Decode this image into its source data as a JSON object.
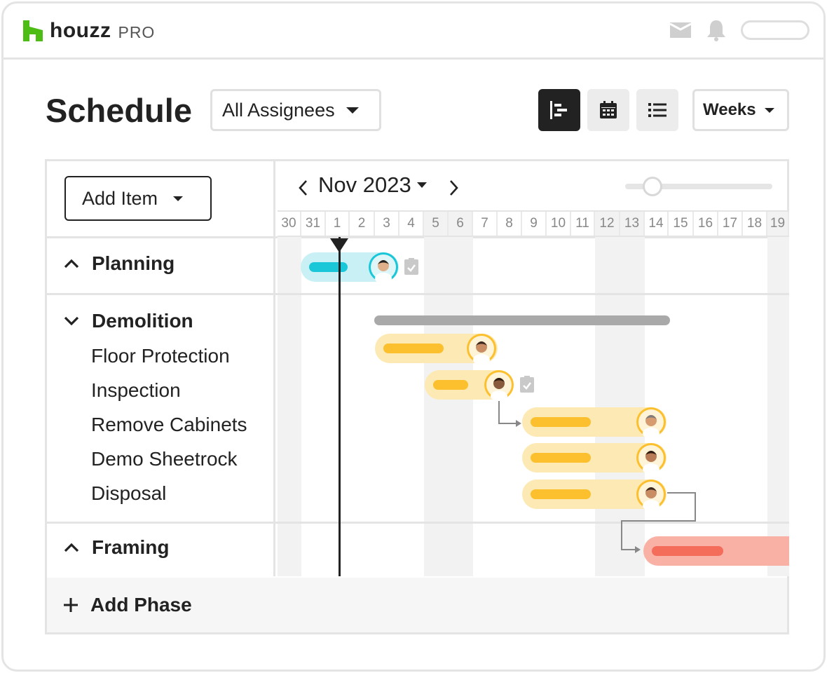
{
  "app": {
    "logo_text": "houzz",
    "logo_suffix": "PRO",
    "brand_color": "#4dbc15"
  },
  "header_icons": [
    "mail-icon",
    "bell-icon",
    "search-pill"
  ],
  "page": {
    "title": "Schedule",
    "assignee_filter": "All Assignees",
    "views": [
      "gantt-view-icon",
      "calendar-view-icon",
      "list-view-icon"
    ],
    "active_view": "gantt",
    "zoom_select": "Weeks"
  },
  "toolbar": {
    "add_item_label": "Add Item",
    "month_label": "Nov 2023"
  },
  "days": [
    "30",
    "31",
    "1",
    "2",
    "3",
    "4",
    "5",
    "6",
    "7",
    "8",
    "9",
    "10",
    "11",
    "12",
    "13",
    "14",
    "15",
    "16",
    "17",
    "18",
    "19"
  ],
  "today_label": "1",
  "phases": [
    {
      "name": "Planning",
      "expanded": false,
      "color": "#1ac7d8",
      "tasks": []
    },
    {
      "name": "Demolition",
      "expanded": true,
      "color": "#fcc02e",
      "tasks": [
        "Floor Protection",
        "Inspection",
        "Remove Cabinets",
        "Demo Sheetrock",
        "Disposal"
      ]
    },
    {
      "name": "Framing",
      "expanded": false,
      "color": "#f46c5a",
      "tasks": []
    }
  ],
  "add_phase_label": "Add Phase",
  "colors": {
    "gantt_active_bg": "#222222",
    "weekend_shade": "#f2f2f2",
    "planning_bar_bg": "#c9f1f5",
    "demolition_bar_bg": "#fde9b3",
    "framing_bar_bg": "#f9b1a6",
    "summary_bar": "#a9a9a9"
  }
}
